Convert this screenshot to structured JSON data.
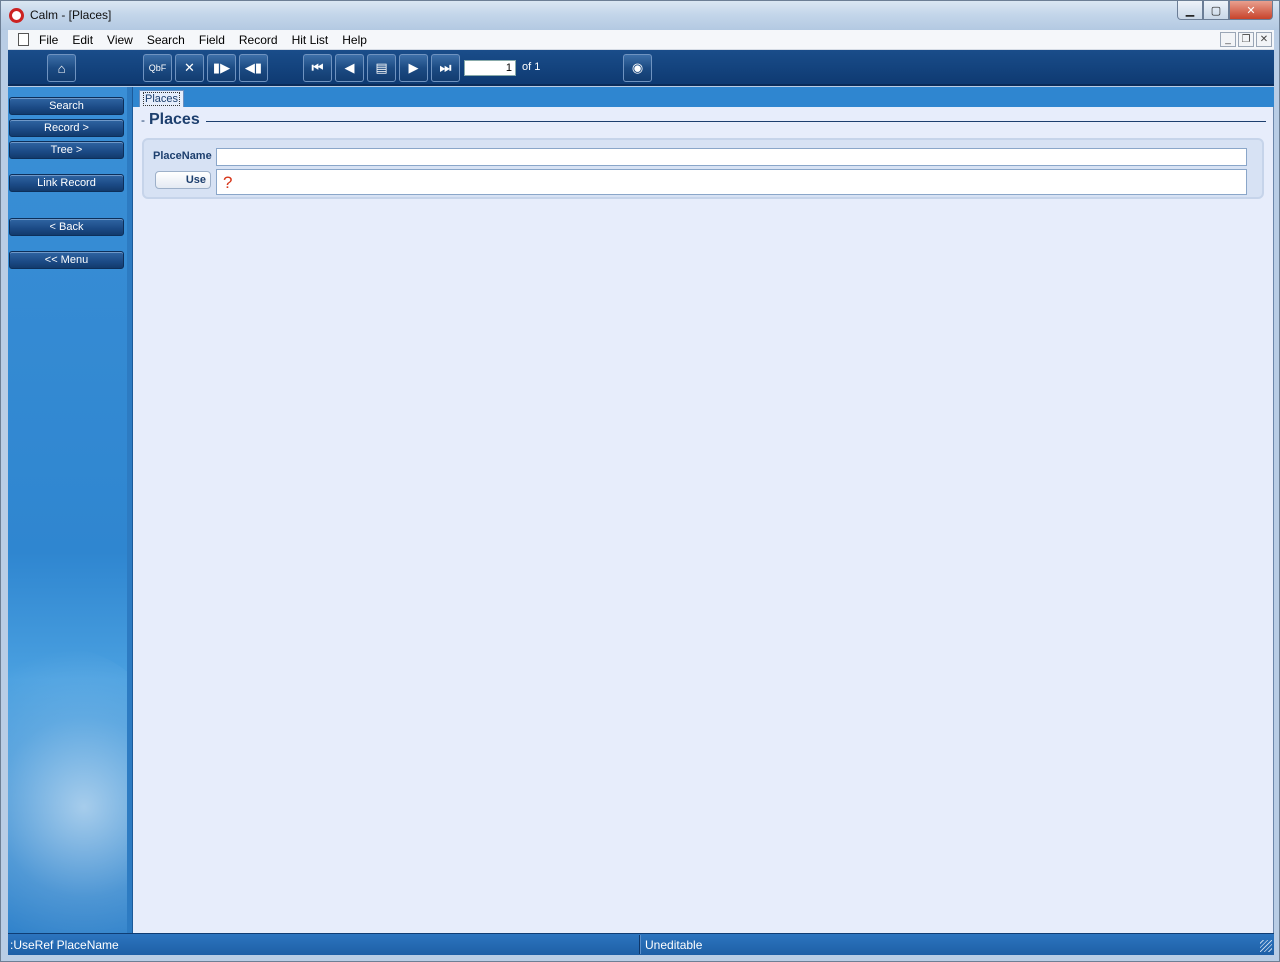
{
  "window": {
    "title": "Calm - [Places]",
    "icon": "calm-app-icon"
  },
  "menubar": {
    "items": [
      {
        "label": "File"
      },
      {
        "label": "Edit"
      },
      {
        "label": "View"
      },
      {
        "label": "Search"
      },
      {
        "label": "Field"
      },
      {
        "label": "Record"
      },
      {
        "label": "Hit List"
      },
      {
        "label": "Help"
      }
    ]
  },
  "toolbar": {
    "qbf_label": "QbF",
    "record_number": "1",
    "record_of": "of 1"
  },
  "leftnav": {
    "search": "Search",
    "record": "Record >",
    "tree": "Tree >",
    "link_record": "Link Record",
    "back": "< Back",
    "menu": "<< Menu"
  },
  "tabs": {
    "active": "Places"
  },
  "section": {
    "title": "Places"
  },
  "fields": {
    "placename_label": "PlaceName",
    "placename_value": "",
    "use_button": "Use",
    "use_value": "?"
  },
  "statusbar": {
    "left": ":UseRef PlaceName",
    "right": "Uneditable"
  }
}
